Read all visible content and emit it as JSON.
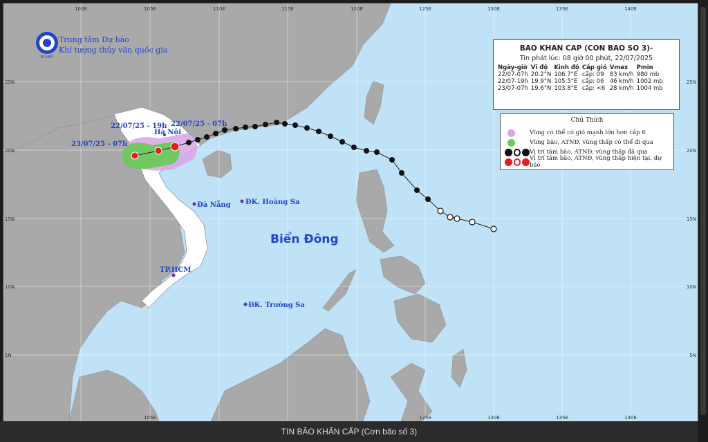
{
  "caption": "TIN BÃO KHẨN CẤP (Cơn bão số 3)",
  "logo": {
    "line1": "Trung tâm Dự báo",
    "line2": "Khí tượng thủy văn quốc gia",
    "badge": "NCHMF"
  },
  "bulletin": {
    "title": "BAO KHAN CAP (CON BAO SO 3)-",
    "issued": "Tin phát lúc: 08 giờ 00 phút, 22/07/2025",
    "headers": [
      "Ngày-giờ",
      "Vĩ độ",
      "Kinh độ",
      "Cấp gió",
      "Vmax",
      "Pmin"
    ],
    "rows": [
      [
        "22/07-07h",
        "20.2°N",
        "106.7°E",
        "cấp: 09",
        "83 km/h",
        "980 mb"
      ],
      [
        "22/07-19h",
        "19.9°N",
        "105.5°E",
        "cấp: 06",
        "46 km/h",
        "1002 mb"
      ],
      [
        "23/07-07h",
        "19.6°N",
        "103.8°E",
        "cấp: <6",
        "28 km/h",
        "1004 mb"
      ]
    ]
  },
  "legend": {
    "title": "Chú Thích",
    "items": [
      "Vùng có thể có gió mạnh lớn hơn cấp 6",
      "Vùng bão, ATNĐ, vùng thấp có thể đi qua",
      "Vị trí tâm bão, ATNĐ, vùng thấp đã qua",
      "Vị trí tâm bão, ATNĐ, vùng thấp hiện tại, dự báo"
    ],
    "colors": {
      "wind_zone": "#d9a3e6",
      "track_zone": "#66cc55",
      "past": "#111111",
      "forecast": "#e02020"
    }
  },
  "map": {
    "lon_labels": [
      "100E",
      "105E",
      "110E",
      "115E",
      "120E",
      "125E",
      "130E",
      "135E",
      "140E"
    ],
    "lat_labels": [
      "25N",
      "20N",
      "15N",
      "10N",
      "5N"
    ],
    "places": {
      "ha_noi": "Hà Nội",
      "da_nang": "Đà Nẵng",
      "hoang_sa": "ĐK. Hoàng Sa",
      "tphcm": "TP.HCM",
      "truong_sa": "ĐK. Trường Sa",
      "sea": "Biển Đông"
    },
    "forecast_labels": [
      "22/07/25 - 19h",
      "22/07/25 - 07h",
      "23/07/25 - 07h"
    ],
    "colors": {
      "sea": "#bfe2f7",
      "land": "#a9a9a9",
      "vietnam": "#ffffff",
      "grid": "#ffffff"
    }
  }
}
